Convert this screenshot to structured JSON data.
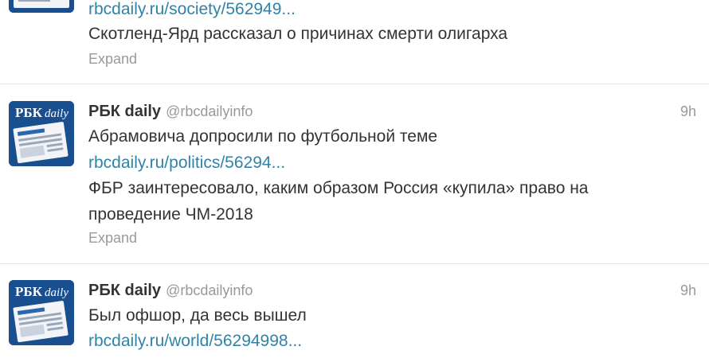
{
  "tweets": [
    {
      "link": "rbcdaily.ru/society/562949...",
      "text_lines": [
        "Скотленд-Ярд  рассказал о причинах смерти олигарха"
      ],
      "expand_label": "Expand"
    },
    {
      "author": "РБК daily",
      "handle": "@rbcdailyinfo",
      "time": "9h",
      "headline": "Абрамовича допросили по футбольной теме",
      "link": "rbcdaily.ru/politics/56294...",
      "text_lines": [
        "ФБР заинтересовало, каким образом Россия «купила» право на",
        "проведение ЧМ-2018"
      ],
      "expand_label": "Expand"
    },
    {
      "author": "РБК daily",
      "handle": "@rbcdailyinfo",
      "time": "9h",
      "headline": "Был офшор, да весь вышел",
      "link": "rbcdaily.ru/world/56294998..."
    }
  ],
  "avatar": {
    "logo_text_bold": "РБК",
    "logo_text_script": "daily",
    "colors": {
      "background": "#1a4f8f",
      "paper": "#f2f4f7",
      "accent": "#2b66b0"
    }
  },
  "colors": {
    "link": "#2f83a8",
    "name": "#333333",
    "muted": "#999999",
    "divider": "#e6e6e6"
  }
}
